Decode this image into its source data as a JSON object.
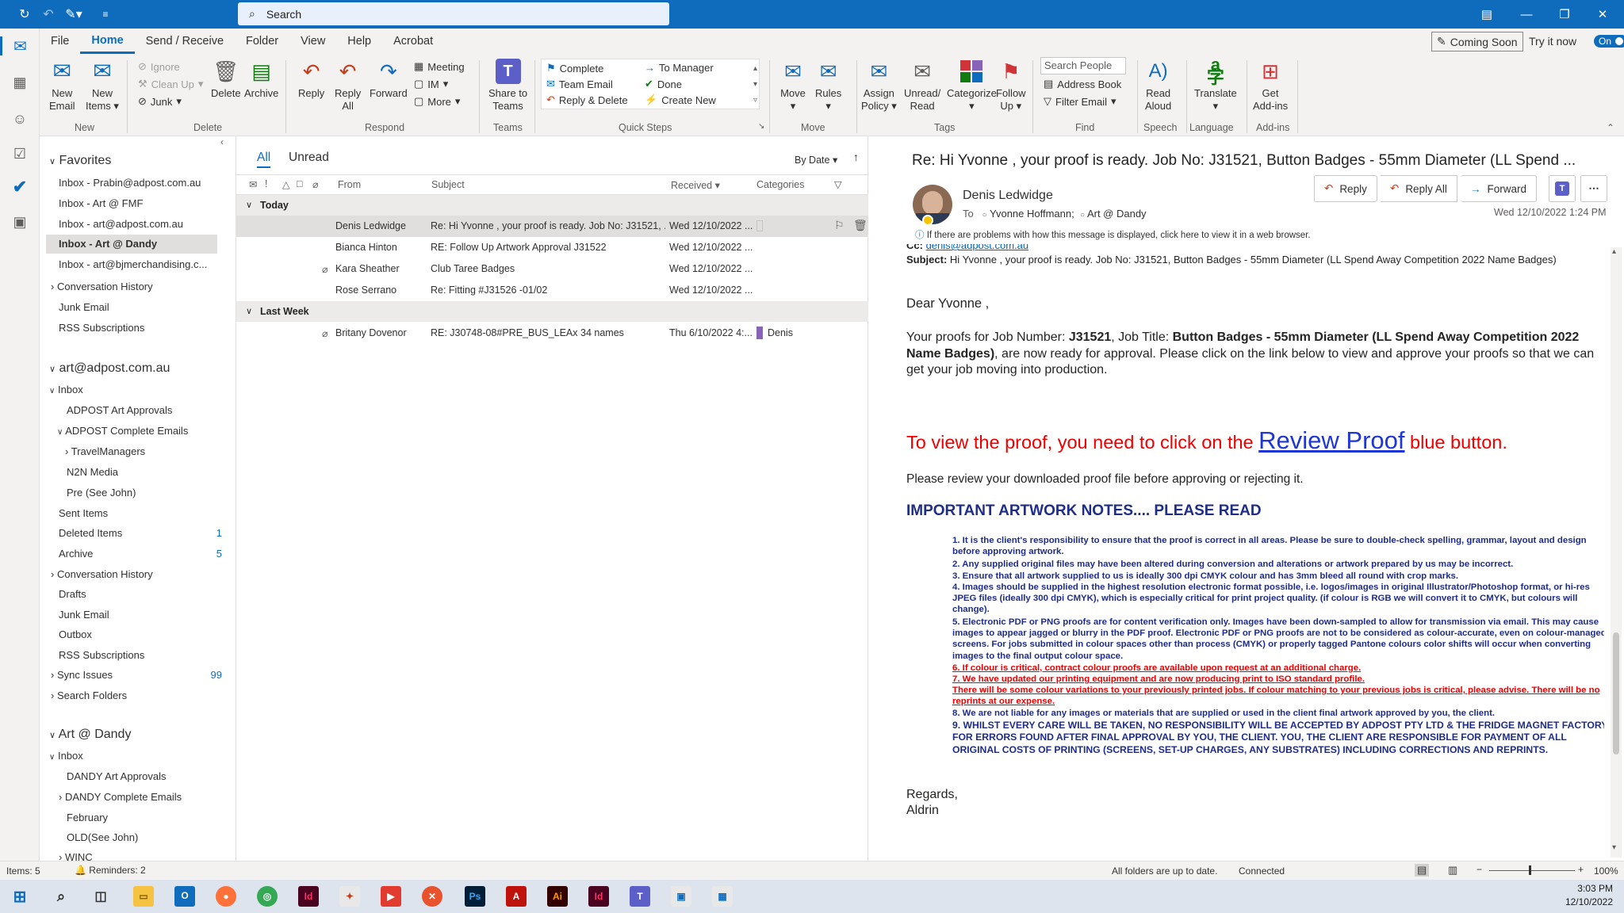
{
  "titlebar": {
    "search_placeholder": "Search"
  },
  "ribbon": {
    "tabs": [
      "File",
      "Home",
      "Send / Receive",
      "Folder",
      "View",
      "Help",
      "Acrobat"
    ],
    "coming_soon": "Coming Soon",
    "try_it_now": "Try it now",
    "toggle": "On",
    "new_email": [
      "New",
      "Email"
    ],
    "new_items": [
      "New",
      "Items"
    ],
    "ignore": "Ignore",
    "clean_up": "Clean Up",
    "junk": "Junk",
    "delete": "Delete",
    "archive": "Archive",
    "reply": "Reply",
    "reply_all": [
      "Reply",
      "All"
    ],
    "forward": "Forward",
    "meeting": "Meeting",
    "im": "IM",
    "more": "More",
    "share_teams": [
      "Share to",
      "Teams"
    ],
    "qs_complete": "Complete",
    "qs_team_email": "Team Email",
    "qs_reply_delete": "Reply & Delete",
    "qs_to_manager": "To Manager",
    "qs_done": "Done",
    "qs_create_new": "Create New",
    "move": "Move",
    "rules": "Rules",
    "assign_policy": [
      "Assign",
      "Policy"
    ],
    "unread_read": [
      "Unread/",
      "Read"
    ],
    "categorize": "Categorize",
    "follow_up": [
      "Follow",
      "Up"
    ],
    "search_people": "Search People",
    "address_book": "Address Book",
    "filter_email": "Filter Email",
    "read_aloud": [
      "Read",
      "Aloud"
    ],
    "translate": "Translate",
    "get_addins": [
      "Get",
      "Add-ins"
    ],
    "groups": [
      "New",
      "Delete",
      "Respond",
      "Teams",
      "Quick Steps",
      "Move",
      "Tags",
      "Find",
      "Speech",
      "Language",
      "Add-ins"
    ]
  },
  "folders": {
    "favorites": "Favorites",
    "fav_items": [
      "Inbox - Prabin@adpost.com.au",
      "Inbox - Art @ FMF",
      "Inbox - art@adpost.com.au",
      "Inbox - Art @ Dandy",
      "Inbox - art@bjmerchandising.c..."
    ],
    "misc": [
      "Conversation History",
      "Junk Email",
      "RSS Subscriptions"
    ],
    "account1": "art@adpost.com.au",
    "a1_items": {
      "inbox": "Inbox",
      "adpost_approvals": "ADPOST Art Approvals",
      "adpost_complete": "ADPOST Complete Emails",
      "travel": "TravelManagers",
      "n2n": "N2N Media",
      "pre": "Pre (See John)",
      "sent": "Sent Items",
      "deleted": "Deleted Items",
      "deleted_count": "1",
      "archive": "Archive",
      "archive_count": "5",
      "conv": "Conversation History",
      "drafts": "Drafts",
      "junk": "Junk Email",
      "outbox": "Outbox",
      "rss": "RSS Subscriptions",
      "sync": "Sync Issues",
      "sync_count": "99",
      "search": "Search Folders"
    },
    "account2": "Art @ Dandy",
    "a2_items": {
      "inbox": "Inbox",
      "dandy_approvals": "DANDY Art Approvals",
      "dandy_complete": "DANDY Complete Emails",
      "feb": "February",
      "old": "OLD(See John)",
      "winc": "WINC"
    }
  },
  "msglist": {
    "tab_all": "All",
    "tab_unread": "Unread",
    "sort": "By Date",
    "col_from": "From",
    "col_subject": "Subject",
    "col_received": "Received",
    "col_categories": "Categories",
    "group_today": "Today",
    "group_lastweek": "Last Week",
    "rows": [
      {
        "from": "Denis Ledwidge",
        "subject": "Re: Hi Yvonne , your proof is ready. Job No: J31521, ...",
        "received": "Wed 12/10/2022 ...",
        "category": ""
      },
      {
        "from": "Bianca Hinton",
        "subject": "RE: Follow Up Artwork Approval J31522",
        "received": "Wed 12/10/2022 ...",
        "category": ""
      },
      {
        "from": "Kara Sheather",
        "subject": "Club Taree Badges",
        "received": "Wed 12/10/2022 ...",
        "category": ""
      },
      {
        "from": "Rose Serrano",
        "subject": "Re: Fitting #J31526 -01/02",
        "received": "Wed 12/10/2022 ...",
        "category": ""
      },
      {
        "from": "Britany Dovenor",
        "subject": "RE: J30748-08#PRE_BUS_LEAx 34 names",
        "received": "Thu 6/10/2022 4:...",
        "category": "Denis"
      }
    ]
  },
  "reading": {
    "subject": "Re: Hi Yvonne , your proof is ready. Job No: J31521, Button Badges - 55mm Diameter (LL Spend ...",
    "sender": "Denis Ledwidge",
    "to_label": "To",
    "to1": "Yvonne Hoffmann;",
    "to2": "Art @ Dandy",
    "reply": "Reply",
    "reply_all": "Reply All",
    "forward": "Forward",
    "date": "Wed 12/10/2022 1:24 PM",
    "info": "If there are problems with how this message is displayed, click here to view it in a web browser.",
    "cc_label": "Cc:",
    "cc_value": "denis@adpost.com.au",
    "subject_label": "Subject:",
    "subject_line": "Hi Yvonne , your proof is ready. Job No: J31521, Button Badges - 55mm Diameter (LL Spend Away Competition 2022 Name Badges)",
    "greeting": "Dear Yvonne ,",
    "p1_a": "Your proofs for Job Number: ",
    "p1_job": "J31521",
    "p1_b": ", Job Title: ",
    "p1_title": "Button Badges - 55mm Diameter (LL Spend Away Competition 2022 Name Badges)",
    "p1_c": ", are now ready for approval. Please click on the link below to view and approve your proofs so that we can get your job moving into production.",
    "view_a": "To view the proof, you need to click on the",
    "review_proof": "Review Proof",
    "view_b": "blue button.",
    "review_note": "Please review your downloaded proof file before approving or rejecting it.",
    "notes_heading": "IMPORTANT ARTWORK NOTES.... PLEASE READ",
    "notes": [
      "1.   It is the client's responsibility to ensure that the proof is correct in all areas. Please be sure to double-check spelling, grammar, layout and design before approving artwork.",
      "2.   Any supplied original files may have been altered during conversion and alterations or artwork prepared by us may be incorrect.",
      "3.   Ensure that all artwork supplied to us is ideally 300 dpi CMYK colour and has 3mm bleed all round with crop marks.",
      "4.   Images should be supplied in the highest resolution electronic format possible, i.e. logos/images in original Illustrator/Photoshop format, or hi-res JPEG files (ideally 300 dpi CMYK), which is especially critical for print project quality. (if colour is RGB we will convert it to CMYK, but colours will change).",
      "5.   Electronic PDF or PNG proofs are for content verification only. Images have been down-sampled to allow for transmission via email. This may cause images to appear jagged or blurry in the PDF proof. Electronic PDF or PNG proofs are not to be considered as colour-accurate, even on colour-managed screens. For jobs submitted in colour spaces other than process (CMYK) or properly tagged Pantone colours color shifts will occur when converting images to the final output colour space."
    ],
    "note6": "6.   If colour is critical, contract colour proofs are available upon request at an additional charge.",
    "note7": "7.   We have updated our printing equipment and are now producing print to ISO standard profile.",
    "note7b": "There will be some colour variations to your previously printed jobs. If colour matching to your previous jobs is critical, please advise. There will be no reprints at our expense.",
    "note8": "8.   We are not liable for any images or materials that are supplied or used in the client final artwork approved by you, the client.",
    "note9": "9.   WHILST EVERY CARE WILL BE TAKEN, NO RESPONSIBILITY WILL BE ACCEPTED BY ADPOST PTY LTD & THE FRIDGE MAGNET FACTORY FOR ERRORS FOUND AFTER FINAL APPROVAL BY YOU, THE CLIENT. YOU, THE CLIENT ARE RESPONSIBLE FOR PAYMENT OF ALL ORIGINAL COSTS OF PRINTING (SCREENS, SET-UP CHARGES, ANY SUBSTRATES) INCLUDING CORRECTIONS AND REPRINTS.",
    "regards": "Regards,",
    "signoff": "Aldrin"
  },
  "status": {
    "items": "Items: 5",
    "reminders": "Reminders: 2",
    "folders": "All folders are up to date.",
    "connected": "Connected",
    "zoom": "100%"
  },
  "taskbar": {
    "time": "3:03 PM",
    "date": "12/10/2022"
  },
  "colors": {
    "accent": "#0f6cbd",
    "red": "#e00000",
    "notes_blue": "#1f2d8a"
  }
}
